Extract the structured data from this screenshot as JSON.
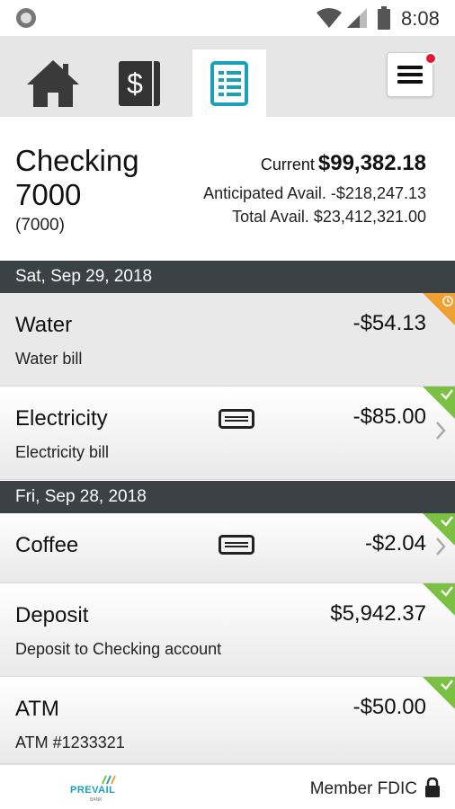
{
  "status_bar": {
    "time": "8:08"
  },
  "tabs": [
    {
      "icon": "home-icon"
    },
    {
      "icon": "dollar-icon"
    },
    {
      "icon": "register-icon",
      "active": true
    }
  ],
  "colors": {
    "accent": "#1aa0b7",
    "date_bar": "#3b4245",
    "cleared": "#7ac143",
    "pending": "#f0a030",
    "badge": "#e8192c"
  },
  "account": {
    "name": "Checking 7000",
    "number": "(7000)",
    "current_label": "Current",
    "current_value": "$99,382.18",
    "anticipated": "Anticipated Avail. -$218,247.13",
    "total": "Total Avail. $23,412,321.00"
  },
  "groups": [
    {
      "date": "Sat, Sep 29, 2018",
      "transactions": [
        {
          "name": "Water",
          "amount": "-$54.13",
          "desc": "Water bill",
          "status": "pending"
        },
        {
          "name": "Electricity",
          "amount": "-$85.00",
          "desc": "Electricity bill",
          "status": "cleared"
        }
      ]
    },
    {
      "date": "Fri, Sep 28, 2018",
      "transactions": [
        {
          "name": "Coffee",
          "amount": "-$2.04",
          "desc": "",
          "status": "cleared"
        },
        {
          "name": "Deposit",
          "amount": "$5,942.37",
          "desc": "Deposit to Checking account",
          "status": "cleared"
        },
        {
          "name": "ATM",
          "amount": "-$50.00",
          "desc": "ATM #1233321",
          "status": "cleared"
        }
      ]
    }
  ],
  "footer": {
    "logo_text": "PREVAIL",
    "logo_sub": "BANK",
    "fdic": "Member FDIC"
  }
}
